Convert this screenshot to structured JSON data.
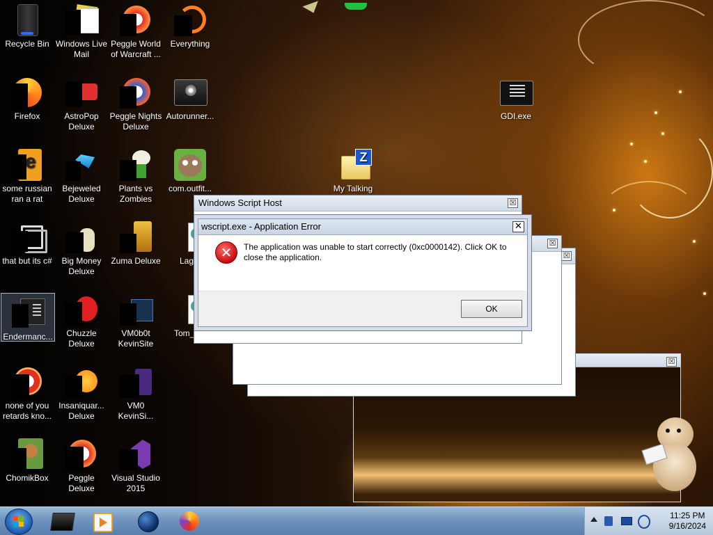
{
  "desktop_icons": [
    {
      "label": "Recycle Bin",
      "icon": "recycle-bin-icon"
    },
    {
      "label": "Windows Live\nMail",
      "icon": "mail-icon"
    },
    {
      "label": "Peggle World\nof Warcraft ...",
      "icon": "peggle-icon"
    },
    {
      "label": "Everything",
      "icon": "search-app-icon"
    },
    {
      "label": "Firefox",
      "icon": "firefox-icon"
    },
    {
      "label": "AstroPop\nDeluxe",
      "icon": "game-icon"
    },
    {
      "label": "Peggle Nights\nDeluxe",
      "icon": "peggle-icon"
    },
    {
      "label": "Autorunner...",
      "icon": "autorun-icon"
    },
    {
      "label": "some russian\nran a rat",
      "icon": "app-icon"
    },
    {
      "label": "Bejeweled\nDeluxe",
      "icon": "gem-icon"
    },
    {
      "label": "Plants vs\nZombies",
      "icon": "plant-icon"
    },
    {
      "label": "com.outfit...",
      "icon": "cat-icon"
    },
    {
      "label": "that but its c#",
      "icon": "shortcut-icon"
    },
    {
      "label": "Big Money\nDeluxe",
      "icon": "game-icon"
    },
    {
      "label": "Zuma Deluxe",
      "icon": "zuma-icon"
    },
    {
      "label": "Lag...",
      "icon": "script-icon"
    },
    {
      "label": "Endermanc...",
      "icon": "window-icon"
    },
    {
      "label": "Chuzzle\nDeluxe",
      "icon": "game-icon"
    },
    {
      "label": "VM0b0t\nKevinSite",
      "icon": "vm-icon"
    },
    {
      "label": "Tom_1...",
      "icon": "script-icon"
    },
    {
      "label": "none of you\nretards kno...",
      "icon": "app-icon"
    },
    {
      "label": "Insaniquar...\nDeluxe",
      "icon": "fish-icon"
    },
    {
      "label": "VM0\nKevinSi...",
      "icon": "vm-icon"
    },
    {
      "label": "ChomikBox",
      "icon": "hamster-icon"
    },
    {
      "label": "Peggle Deluxe",
      "icon": "peggle-icon"
    },
    {
      "label": "Visual Studio\n2015",
      "icon": "visual-studio-icon"
    },
    {
      "label": "GDI.exe",
      "icon": "exe-icon"
    },
    {
      "label": "My Talking",
      "icon": "folder-zip-icon"
    }
  ],
  "windows": {
    "script_host_title": "Windows Script Host",
    "error": {
      "title": "wscript.exe - Application Error",
      "message": "The application was unable to start correctly (0xc0000142). Click OK to close the application.",
      "ok_label": "OK",
      "close_glyph": "✕"
    },
    "close_glyph": "☒"
  },
  "taskbar": {
    "time": "11:25 PM",
    "date": "9/16/2024",
    "pinned": [
      "terminal-icon",
      "media-player-icon",
      "globe-icon",
      "firefox-icon"
    ]
  },
  "colors": {
    "error_red": "#c70f0f",
    "taskbar_blue": "#6f93bd"
  }
}
